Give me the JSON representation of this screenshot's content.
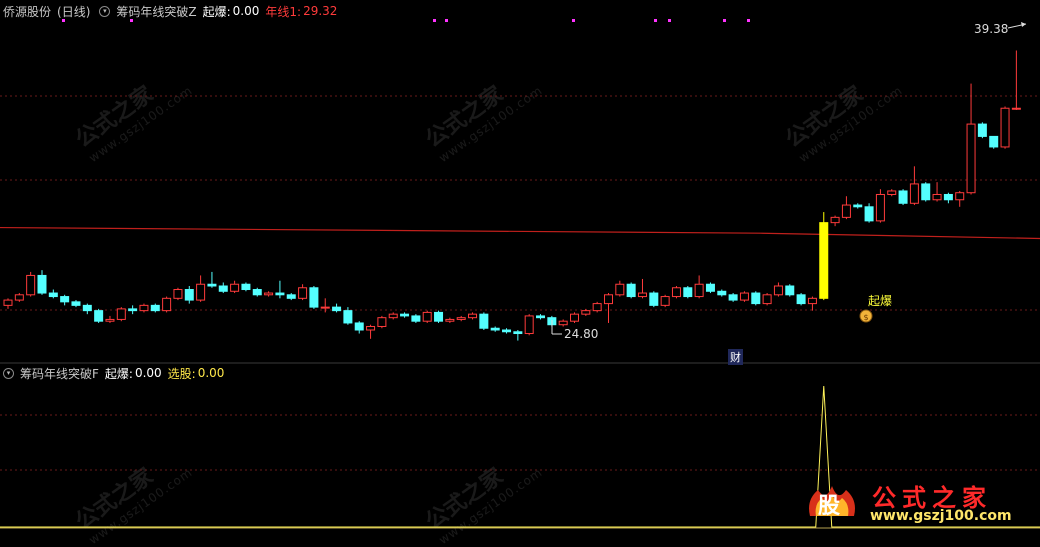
{
  "top_panel": {
    "stock_name": "侨源股份",
    "period": "(日线)",
    "indicator_name": "筹码年线突破Z",
    "qibao_label": "起爆:",
    "qibao_value": "0.00",
    "nianxian_label": "年线1:",
    "nianxian_value": "29.32"
  },
  "bottom_panel": {
    "indicator_name": "筹码年线突破F",
    "qibao_label": "起爆:",
    "qibao_value": "0.00",
    "xuangu_label": "选股:",
    "xuangu_value": "0.00"
  },
  "annotations": {
    "high_price": "39.38",
    "low_price": "24.80",
    "qibao_marker": "起爆",
    "cai_marker": "财"
  },
  "watermark": {
    "text": "公式之家",
    "url": "www.gszj100.com"
  },
  "logo": {
    "badge_char": "股",
    "title": "公式之家",
    "url": "www.gszj100.com"
  },
  "colors": {
    "background": "#000000",
    "up_candle": "#ff3b3b",
    "down_candle": "#54ffff",
    "year_line": "#c0201c",
    "signal": "#ffff00",
    "magenta_dots": "#ff33ff"
  },
  "chart_data": {
    "type": "candlestick",
    "price_range": [
      23.5,
      41.0
    ],
    "candles": [
      [
        24.9,
        25.2,
        24.7,
        25.3
      ],
      [
        25.2,
        25.5,
        25.1,
        25.6
      ],
      [
        25.5,
        26.6,
        25.4,
        26.8
      ],
      [
        26.6,
        25.6,
        25.5,
        26.9
      ],
      [
        25.6,
        25.4,
        25.3,
        25.8
      ],
      [
        25.4,
        25.1,
        24.9,
        25.5
      ],
      [
        25.1,
        24.9,
        24.8,
        25.2
      ],
      [
        24.9,
        24.6,
        24.4,
        25.0
      ],
      [
        24.6,
        24.0,
        23.9,
        24.7
      ],
      [
        24.0,
        24.1,
        23.9,
        24.3
      ],
      [
        24.1,
        24.7,
        24.0,
        24.8
      ],
      [
        24.7,
        24.6,
        24.4,
        24.9
      ],
      [
        24.6,
        24.9,
        24.5,
        25.0
      ],
      [
        24.9,
        24.6,
        24.5,
        25.0
      ],
      [
        24.6,
        25.3,
        24.5,
        25.4
      ],
      [
        25.3,
        25.8,
        25.2,
        25.9
      ],
      [
        25.8,
        25.2,
        25.0,
        26.0
      ],
      [
        25.2,
        26.1,
        25.1,
        26.6
      ],
      [
        26.1,
        26.0,
        25.9,
        26.8
      ],
      [
        26.0,
        25.7,
        25.6,
        26.2
      ],
      [
        25.7,
        26.1,
        25.6,
        26.3
      ],
      [
        26.1,
        25.8,
        25.7,
        26.2
      ],
      [
        25.8,
        25.5,
        25.4,
        25.9
      ],
      [
        25.5,
        25.6,
        25.4,
        25.7
      ],
      [
        25.6,
        25.5,
        25.3,
        26.3
      ],
      [
        25.5,
        25.3,
        25.2,
        25.6
      ],
      [
        25.3,
        25.9,
        25.2,
        26.1
      ],
      [
        25.9,
        24.8,
        24.7,
        26.0
      ],
      [
        24.8,
        24.8,
        24.5,
        25.3
      ],
      [
        24.8,
        24.6,
        24.5,
        25.0
      ],
      [
        24.6,
        23.9,
        23.8,
        24.8
      ],
      [
        23.9,
        23.5,
        23.3,
        24.0
      ],
      [
        23.5,
        23.7,
        23.0,
        23.8
      ],
      [
        23.7,
        24.2,
        23.6,
        24.3
      ],
      [
        24.2,
        24.4,
        24.1,
        24.5
      ],
      [
        24.4,
        24.3,
        24.2,
        24.5
      ],
      [
        24.3,
        24.0,
        23.9,
        24.4
      ],
      [
        24.0,
        24.5,
        23.9,
        24.6
      ],
      [
        24.5,
        24.0,
        23.9,
        24.6
      ],
      [
        24.0,
        24.1,
        23.9,
        24.2
      ],
      [
        24.1,
        24.2,
        24.0,
        24.3
      ],
      [
        24.2,
        24.4,
        24.1,
        24.5
      ],
      [
        24.4,
        23.6,
        23.5,
        24.5
      ],
      [
        23.6,
        23.5,
        23.4,
        23.7
      ],
      [
        23.5,
        23.4,
        23.3,
        23.6
      ],
      [
        23.4,
        23.3,
        22.9,
        23.5
      ],
      [
        23.3,
        24.3,
        23.2,
        24.4
      ],
      [
        24.3,
        24.2,
        24.1,
        24.4
      ],
      [
        24.2,
        23.8,
        23.7,
        24.3
      ],
      [
        23.8,
        24.0,
        23.7,
        24.1
      ],
      [
        24.0,
        24.4,
        23.9,
        24.5
      ],
      [
        24.4,
        24.6,
        24.3,
        24.7
      ],
      [
        24.6,
        25.0,
        24.5,
        25.1
      ],
      [
        25.0,
        25.5,
        23.9,
        25.6
      ],
      [
        25.5,
        26.1,
        25.4,
        26.3
      ],
      [
        26.1,
        25.4,
        25.3,
        26.2
      ],
      [
        25.4,
        25.6,
        25.3,
        26.4
      ],
      [
        25.6,
        24.9,
        24.8,
        25.7
      ],
      [
        24.9,
        25.4,
        24.8,
        25.5
      ],
      [
        25.4,
        25.9,
        25.3,
        26.0
      ],
      [
        25.9,
        25.4,
        25.3,
        26.0
      ],
      [
        25.4,
        26.1,
        25.3,
        26.6
      ],
      [
        26.1,
        25.7,
        25.6,
        26.2
      ],
      [
        25.7,
        25.5,
        25.4,
        25.8
      ],
      [
        25.5,
        25.2,
        25.1,
        25.6
      ],
      [
        25.2,
        25.6,
        25.1,
        25.7
      ],
      [
        25.6,
        25.0,
        24.9,
        25.7
      ],
      [
        25.0,
        25.5,
        24.9,
        25.6
      ],
      [
        25.5,
        26.0,
        25.4,
        26.2
      ],
      [
        26.0,
        25.5,
        25.4,
        26.1
      ],
      [
        25.5,
        25.0,
        24.9,
        25.6
      ],
      [
        25.0,
        25.3,
        24.6,
        25.4
      ],
      [
        25.3,
        29.6,
        25.2,
        30.2
      ],
      [
        29.6,
        29.9,
        29.4,
        30.0
      ],
      [
        29.9,
        30.6,
        29.8,
        31.1
      ],
      [
        30.6,
        30.5,
        30.4,
        30.7
      ],
      [
        30.5,
        29.7,
        29.6,
        30.7
      ],
      [
        29.7,
        31.2,
        29.6,
        31.5
      ],
      [
        31.2,
        31.4,
        31.1,
        31.5
      ],
      [
        31.4,
        30.7,
        30.6,
        31.5
      ],
      [
        30.7,
        31.8,
        30.6,
        32.8
      ],
      [
        31.8,
        30.9,
        30.8,
        31.9
      ],
      [
        30.9,
        31.2,
        30.8,
        31.9
      ],
      [
        31.2,
        30.9,
        30.7,
        31.3
      ],
      [
        30.9,
        31.3,
        30.5,
        31.4
      ],
      [
        31.3,
        35.2,
        31.2,
        37.5
      ],
      [
        35.2,
        34.5,
        34.4,
        35.3
      ],
      [
        34.5,
        33.9,
        33.8,
        34.0
      ],
      [
        33.9,
        36.1,
        33.8,
        36.2
      ],
      [
        36.1,
        36.1,
        36.0,
        39.38
      ]
    ],
    "year_line": [
      [
        0,
        29.32
      ],
      [
        1040,
        28.8
      ]
    ],
    "low_annotation": 24.8,
    "high_annotation": 39.38,
    "signal_index": 72,
    "signal_indicator_peak": 1.0
  }
}
